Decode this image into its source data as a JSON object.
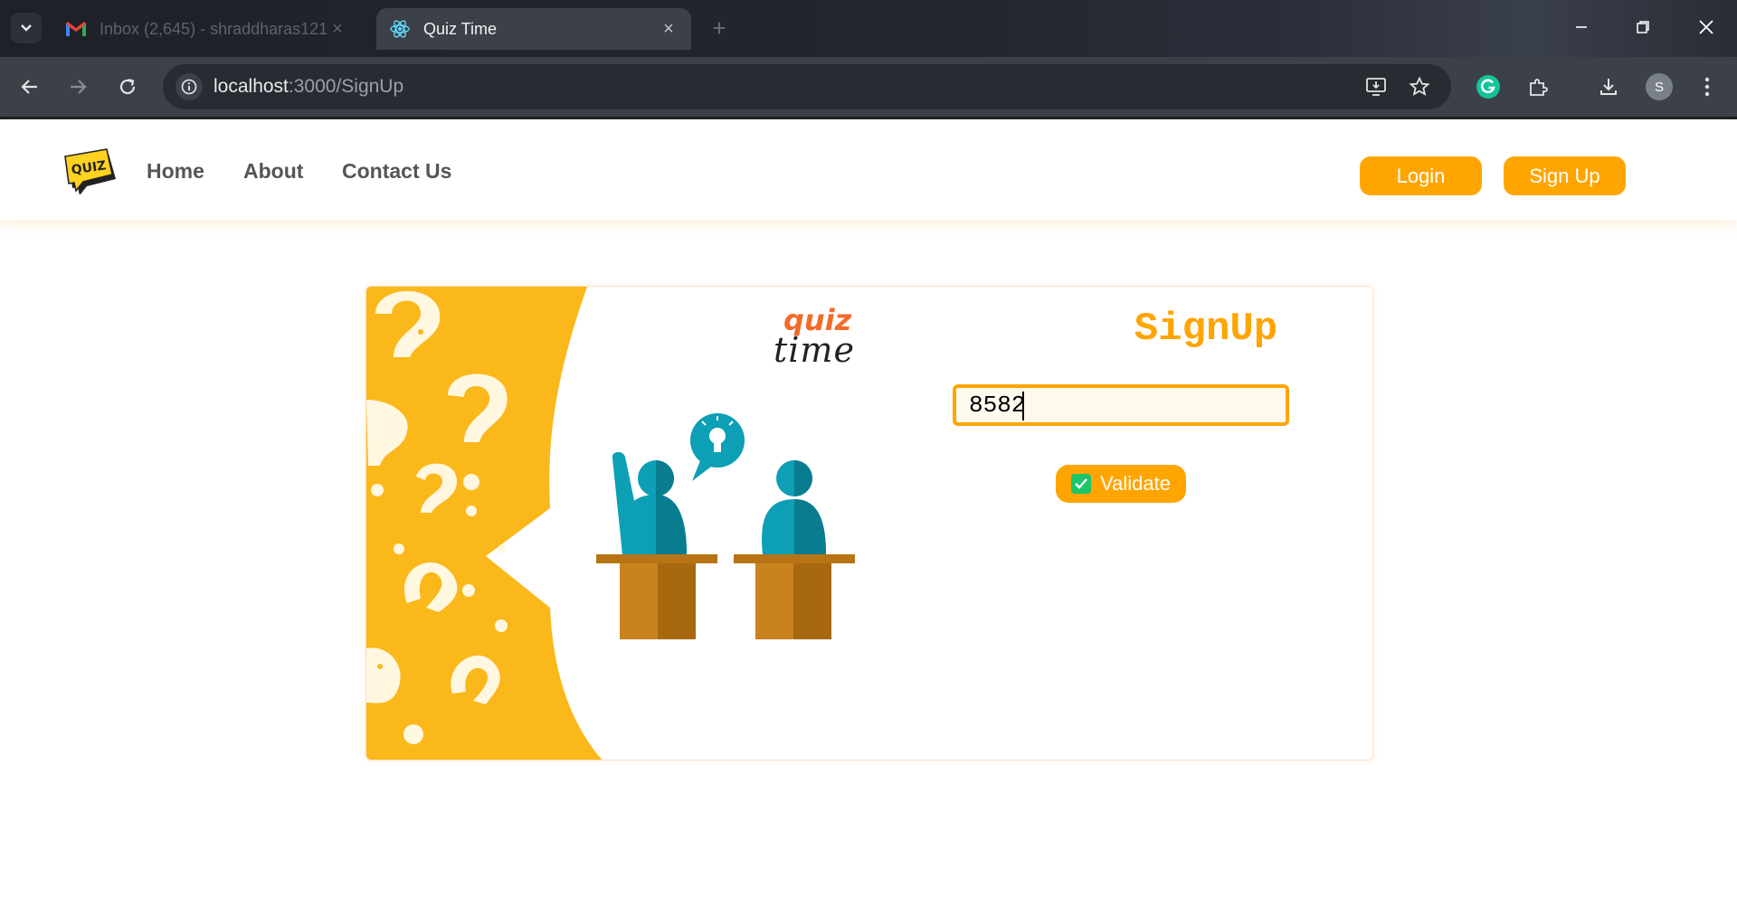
{
  "browser": {
    "tabs": [
      {
        "title": "Inbox (2,645) - shraddharas121",
        "favicon": "gmail-icon",
        "active": false
      },
      {
        "title": "Quiz Time",
        "favicon": "react-icon",
        "active": true
      }
    ],
    "url_host": "localhost",
    "url_path": ":3000/SignUp",
    "profile_initial": "S"
  },
  "navbar": {
    "logo_text": "QUIZ",
    "links": [
      "Home",
      "About",
      "Contact Us"
    ],
    "login_label": "Login",
    "signup_label": "Sign Up"
  },
  "card": {
    "brand_quiz": "quiz",
    "brand_time": "time",
    "heading": "SignUp",
    "otp_value": "8582",
    "validate_label": "Validate"
  },
  "colors": {
    "accent": "#ffa500",
    "illustration_yellow": "#fbb81b",
    "teal": "#0c9fb5",
    "desk": "#c9831e",
    "check": "#1cc46a"
  }
}
